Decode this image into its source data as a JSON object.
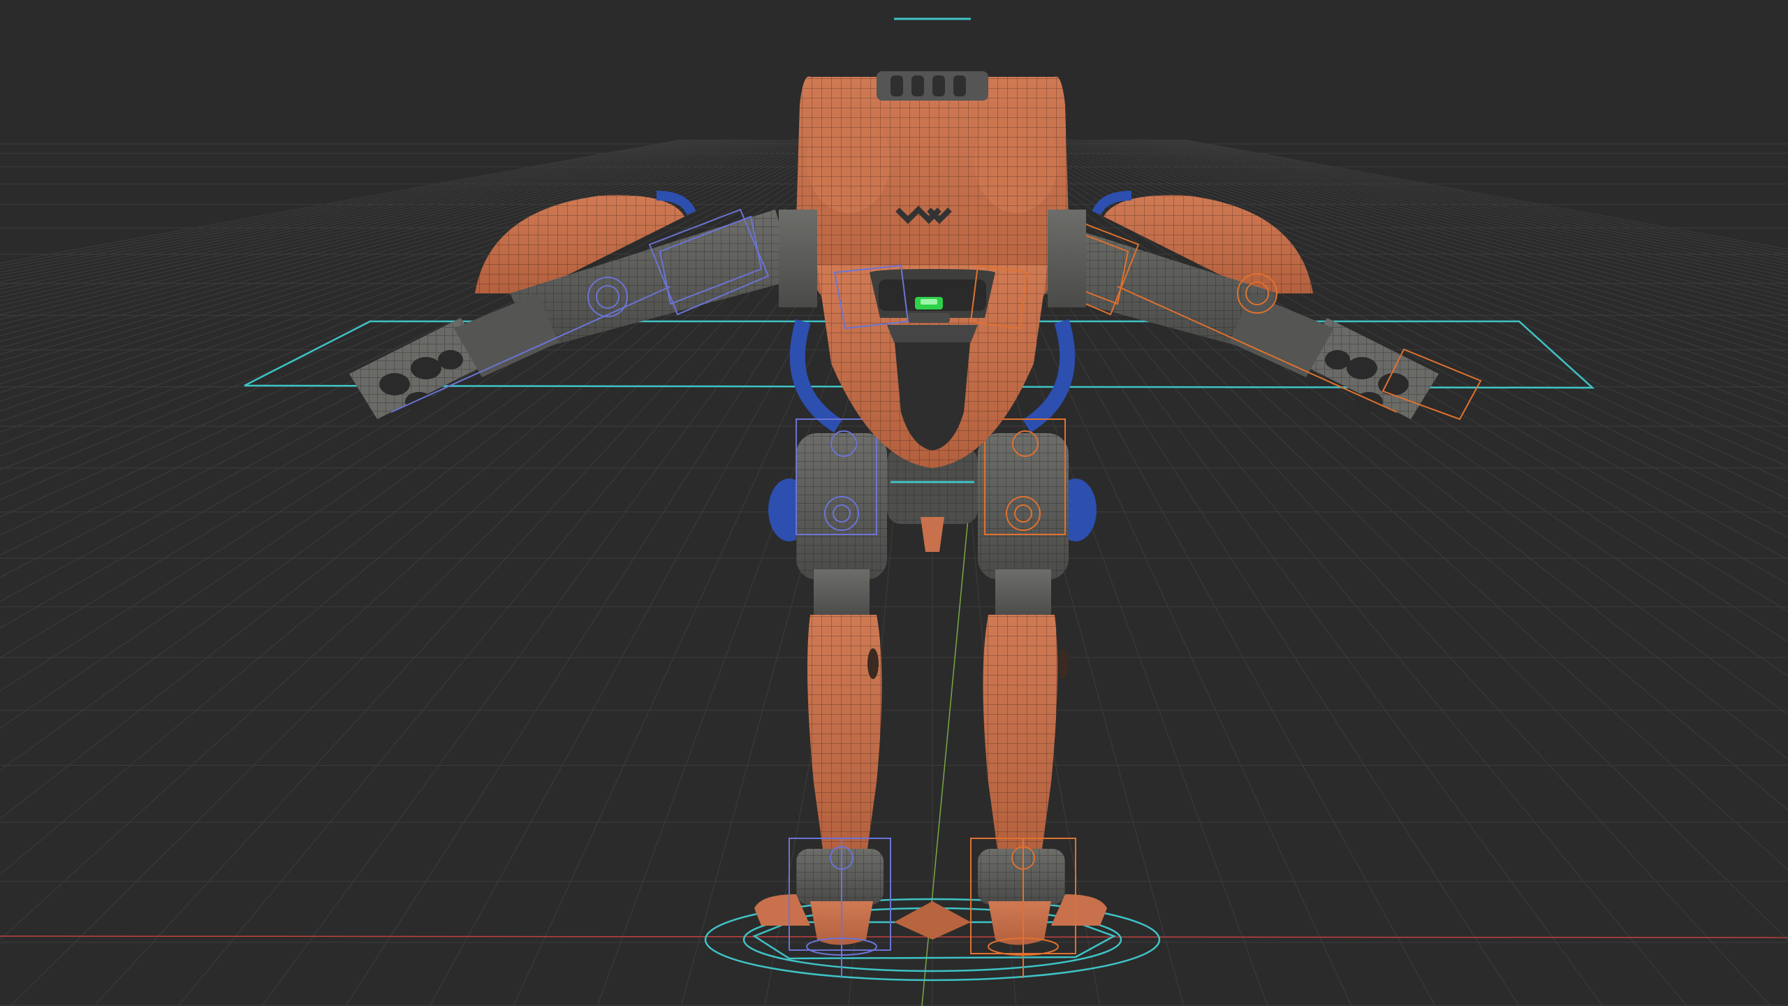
{
  "viewport": {
    "background": "#2b2b2b",
    "grid_color": "#3a3a3a",
    "x_axis_color": "#c0413f",
    "y_axis_color": "#7aa844",
    "rig_cyan": "#3fc3c6",
    "rig_blue": "#6b74d6",
    "rig_orange": "#e0722e"
  },
  "model": {
    "armor_color": "#c8714c",
    "armor_dark": "#8f4a31",
    "metal_color": "#5f5f5c",
    "metal_dark": "#3a3a38",
    "cable_color": "#2c4fb0",
    "visor_color": "#2fd04a",
    "wire_color": "#1e1e1e"
  }
}
